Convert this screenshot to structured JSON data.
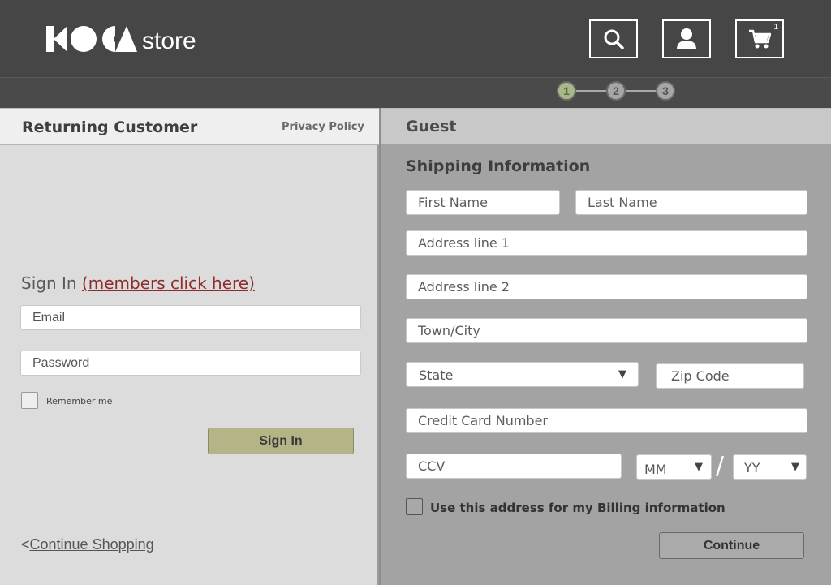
{
  "header": {
    "logo_text": "KOCA",
    "store_label": "store",
    "cart_count": "1"
  },
  "steps": [
    "1",
    "2",
    "3"
  ],
  "returning": {
    "title": "Returning Customer",
    "privacy_link": "Privacy Policy",
    "signin_label": "Sign In",
    "members_link": "(members click here)",
    "email_placeholder": "Email",
    "password_placeholder": "Password",
    "remember_label": "Remember me",
    "signin_button": "Sign In",
    "continue_prefix": "<",
    "continue_link": "Continue Shopping"
  },
  "guest": {
    "title": "Guest",
    "shipping_title": "Shipping Information",
    "first_name": "First Name",
    "last_name": "Last Name",
    "address1": "Address line 1",
    "address2": "Address line 2",
    "city": "Town/City",
    "state": "State",
    "zip": "Zip Code",
    "cc_number": "Credit Card Number",
    "ccv": "CCV",
    "month": "MM",
    "year": "YY",
    "date_separator": "/",
    "billing_label": "Use this address for my Billing information",
    "continue_button": "Continue"
  },
  "colors": {
    "header_bg": "#464646",
    "step_active": "#a9b88a",
    "signin_button": "#b5b487",
    "link_red": "#8f2b2b"
  }
}
